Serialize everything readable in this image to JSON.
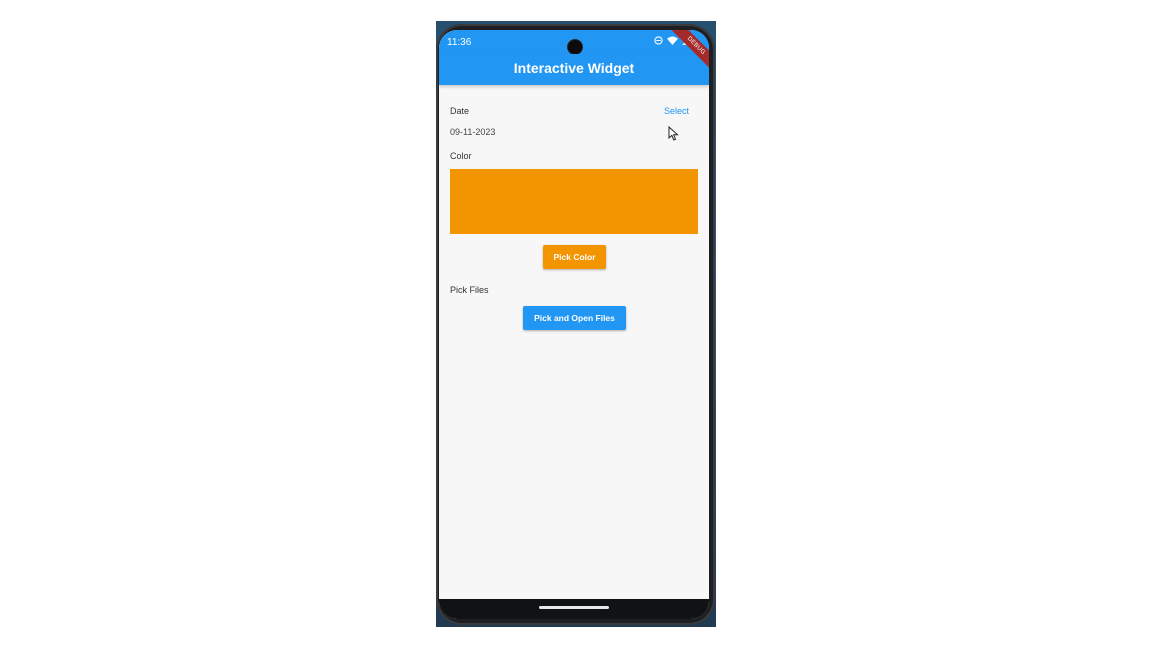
{
  "status_bar": {
    "time": "11:36"
  },
  "debug_banner": "DEBUG",
  "app_bar": {
    "title": "Interactive Widget"
  },
  "date_section": {
    "label": "Date",
    "select_label": "Select",
    "value": "09-11-2023"
  },
  "color_section": {
    "label": "Color",
    "swatch_color": "#f29500",
    "button_label": "Pick Color"
  },
  "files_section": {
    "label": "Pick Files",
    "button_label": "Pick and Open Files"
  },
  "colors": {
    "primary": "#2196f3",
    "accent": "#f29500"
  },
  "icons": [
    "do-not-disturb-icon",
    "wifi-icon",
    "signal-icon",
    "cursor-icon"
  ]
}
